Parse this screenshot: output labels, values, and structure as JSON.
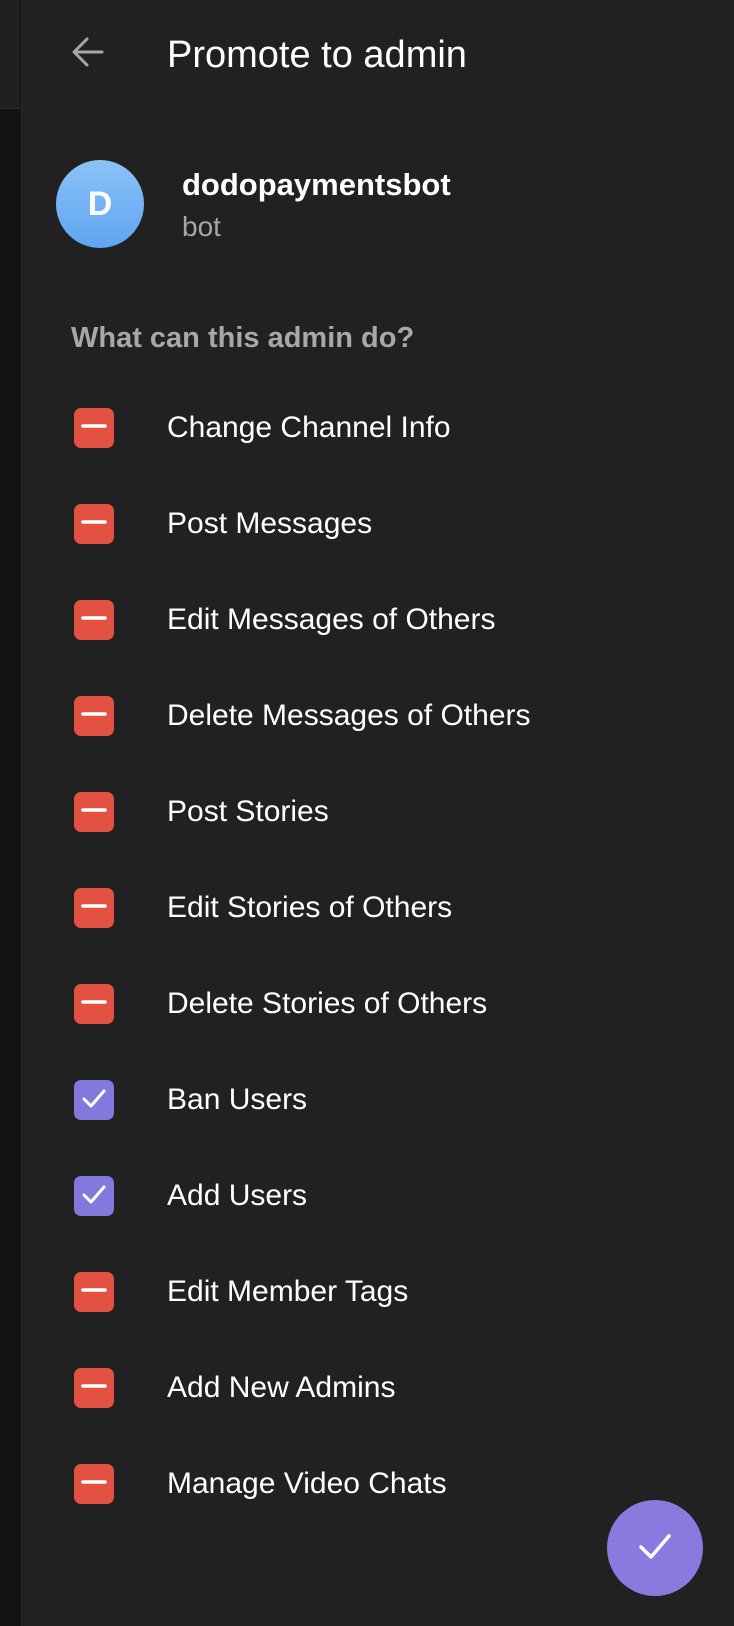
{
  "header": {
    "title": "Promote to admin",
    "back_icon": "arrow-left-icon"
  },
  "profile": {
    "avatar_letter": "D",
    "avatar_color": "#6aaff4",
    "name": "dodopaymentsbot",
    "subtitle": "bot"
  },
  "permissions": {
    "title": "What can this admin do?",
    "items": [
      {
        "label": "Change Channel Info",
        "checked": false
      },
      {
        "label": "Post Messages",
        "checked": false
      },
      {
        "label": "Edit Messages of Others",
        "checked": false
      },
      {
        "label": "Delete Messages of Others",
        "checked": false
      },
      {
        "label": "Post Stories",
        "checked": false
      },
      {
        "label": "Edit Stories of Others",
        "checked": false
      },
      {
        "label": "Delete Stories of Others",
        "checked": false
      },
      {
        "label": "Ban Users",
        "checked": true
      },
      {
        "label": "Add Users",
        "checked": true
      },
      {
        "label": "Edit Member Tags",
        "checked": false
      },
      {
        "label": "Add New Admins",
        "checked": false
      },
      {
        "label": "Manage Video Chats",
        "checked": false
      }
    ]
  },
  "colors": {
    "panel_bg": "#212121",
    "denied": "#e25142",
    "allowed": "#8378db",
    "accent": "#8a7ae0"
  },
  "fab": {
    "icon": "checkmark-icon"
  }
}
